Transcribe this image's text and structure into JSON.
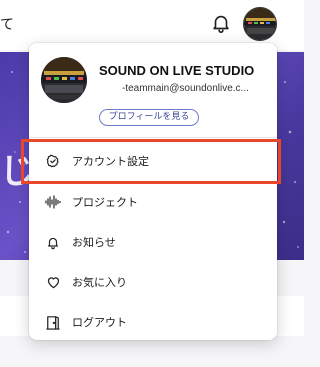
{
  "topbar": {
    "partial_text": "て",
    "bell_icon": "bell-icon"
  },
  "hero": {
    "partial_text": "じ"
  },
  "user": {
    "name": "SOUND ON LIVE STUDIO",
    "email": "-teammain@soundonlive.c...",
    "profile_button": "プロフィールを見る"
  },
  "menu": {
    "items": [
      {
        "label": "アカウント設定",
        "icon": "check-circle-icon"
      },
      {
        "label": "プロジェクト",
        "icon": "waveform-icon"
      },
      {
        "label": "お知らせ",
        "icon": "bell-icon"
      },
      {
        "label": "お気に入り",
        "icon": "heart-icon"
      },
      {
        "label": "ログアウト",
        "icon": "door-icon"
      }
    ],
    "highlighted_index": 0
  },
  "colors": {
    "highlight": "#e8472a",
    "profile_button_border": "#6b7cc8",
    "hero": "#4b3aa8"
  }
}
